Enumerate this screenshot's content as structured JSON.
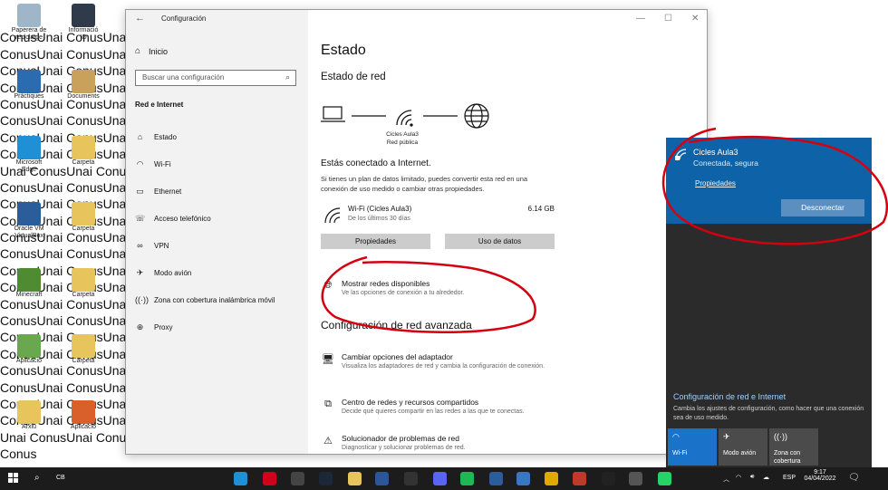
{
  "desktop": {
    "background_lines": [
      "",
      "ConusUnai ConusUnai                                                                                                    ConusUnai ConusUnai",
      "ConusUnai ConusUnai                                                                                                    ConusUnai ConusUnai",
      "ConusUnai ConusUnai                                                                                                    ConusUnai ConusUnai",
      "ConusUnai ConusUnai                                                                                                    ConusUnai ConusUnai",
      "ConusUnai ConusUnai                                                                                                    ConusUnai ConusUnai",
      "ConusUnai ConusUnai                                                                                                    ConusUnai ConusUnai",
      "ConusUnai ConusUnai                                                                                                    ",
      "ConusUnai ConusUnai",
      "Unai ConusUnai Conus",
      "ConusUnai ConusUnai",
      "ConusUnai ConusUnai",
      "ConusUnai ConusUnai",
      "ConusUnai ConusUnai",
      "ConusUnai ConusUnai",
      "ConusUnai ConusUnai",
      "ConusUnai ConusUnai",
      "ConusUnai ConusUnai",
      "ConusUnai ConusUnai",
      "ConusUnai ConusUnai",
      "ConusUnai ConusUnai",
      "ConusUnai ConusUnai",
      "ConusUnai ConusUnai",
      "ConusUnai ConusUnai",
      "ConusUnai ConusUnai",
      "Unai ConusUnai Conus",
      "Conus"
    ],
    "icons": [
      {
        "label": "Paperera de reciclatge",
        "color": "#9fb6c9"
      },
      {
        "label": "Informació IO",
        "color": "#2f3a4a"
      },
      {
        "label": "Pràctiques",
        "color": "#2b6cb0"
      },
      {
        "label": "Documents",
        "color": "#c9a15a"
      },
      {
        "label": "Microsoft Edge",
        "color": "#1f8fd6"
      },
      {
        "label": "Carpeta",
        "color": "#e8c45c"
      },
      {
        "label": "Oracle VM VirtualBox",
        "color": "#2a5d9a"
      },
      {
        "label": "Carpeta",
        "color": "#e8c45c"
      },
      {
        "label": "Minecraft",
        "color": "#4f8b32"
      },
      {
        "label": "Carpeta",
        "color": "#e8c45c"
      },
      {
        "label": "Aplicació",
        "color": "#6aa84f"
      },
      {
        "label": "Carpeta",
        "color": "#e8c45c"
      },
      {
        "label": "Arxiu",
        "color": "#e8c45c"
      },
      {
        "label": "Aplicació",
        "color": "#d95f2b"
      }
    ]
  },
  "window": {
    "title": "Configuración",
    "home": "Inicio",
    "search_placeholder": "Buscar una configuración",
    "section": "Red e Internet",
    "nav": [
      {
        "label": "Estado",
        "icon": "home-globe-icon"
      },
      {
        "label": "Wi-Fi",
        "icon": "wifi-icon"
      },
      {
        "label": "Ethernet",
        "icon": "ethernet-icon"
      },
      {
        "label": "Acceso telefónico",
        "icon": "dialup-icon"
      },
      {
        "label": "VPN",
        "icon": "vpn-icon"
      },
      {
        "label": "Modo avión",
        "icon": "airplane-icon"
      },
      {
        "label": "Zona con cobertura inalámbrica móvil",
        "icon": "hotspot-icon"
      },
      {
        "label": "Proxy",
        "icon": "globe-icon"
      }
    ],
    "main": {
      "title": "Estado",
      "network_status_heading": "Estado de red",
      "network_name": "Cicles Aula3",
      "network_type": "Red pública",
      "connected_heading": "Estás conectado a Internet.",
      "connected_desc": "Si tienes un plan de datos limitado, puedes convertir esta red en una conexión de uso medido o cambiar otras propiedades.",
      "wifi_label": "Wi-Fi (Cicles Aula3)",
      "wifi_period": "De los últimos 30 días",
      "wifi_usage": "6.14 GB",
      "btn_properties": "Propiedades",
      "btn_data_usage": "Uso de datos",
      "show_networks_title": "Mostrar redes disponibles",
      "show_networks_desc": "Ve las opciones de conexión a tu alrededor.",
      "advanced_heading": "Configuración de red avanzada",
      "adapter_title": "Cambiar opciones del adaptador",
      "adapter_desc": "Visualiza los adaptadores de red y cambia la configuración de conexión.",
      "center_title": "Centro de redes y recursos compartidos",
      "center_desc": "Decide qué quieres compartir en las redes a las que te conectas.",
      "troubleshoot_title": "Solucionador de problemas de red",
      "troubleshoot_desc": "Diagnosticar y solucionar problemas de red."
    }
  },
  "flyout": {
    "network_name": "Cicles Aula3",
    "status": "Conectada, segura",
    "properties": "Propiedades",
    "disconnect": "Desconectar",
    "settings_link": "Configuración de red e Internet",
    "settings_desc": "Cambia los ajustes de configuración, como hacer que una conexión sea de uso medido.",
    "tiles": [
      {
        "label": "Wi-Fi",
        "active": true
      },
      {
        "label": "Modo avión",
        "active": false
      },
      {
        "label": "Zona con cobertura",
        "active": false
      }
    ]
  },
  "taskbar": {
    "search_text": "CB",
    "language": "ESP",
    "time": "9:17",
    "date": "04/04/2022",
    "apps": [
      {
        "name": "edge",
        "color": "#1f8fd6"
      },
      {
        "name": "opera",
        "color": "#d0021b"
      },
      {
        "name": "unity",
        "color": "#444444"
      },
      {
        "name": "steam",
        "color": "#1b2838"
      },
      {
        "name": "file-explorer",
        "color": "#e8c45c"
      },
      {
        "name": "word",
        "color": "#2b579a"
      },
      {
        "name": "epic-games",
        "color": "#333333"
      },
      {
        "name": "discord",
        "color": "#5865f2"
      },
      {
        "name": "spotify",
        "color": "#1db954"
      },
      {
        "name": "virtualbox",
        "color": "#2a5d9a"
      },
      {
        "name": "app",
        "color": "#3a77c2"
      },
      {
        "name": "chrome",
        "color": "#e0a800"
      },
      {
        "name": "app-red",
        "color": "#c0392b"
      },
      {
        "name": "capcut",
        "color": "#222222"
      },
      {
        "name": "settings",
        "color": "#555555"
      },
      {
        "name": "whatsapp",
        "color": "#25d366"
      }
    ]
  },
  "colors": {
    "accent": "#0e63a8",
    "annotation": "#d4000f"
  }
}
